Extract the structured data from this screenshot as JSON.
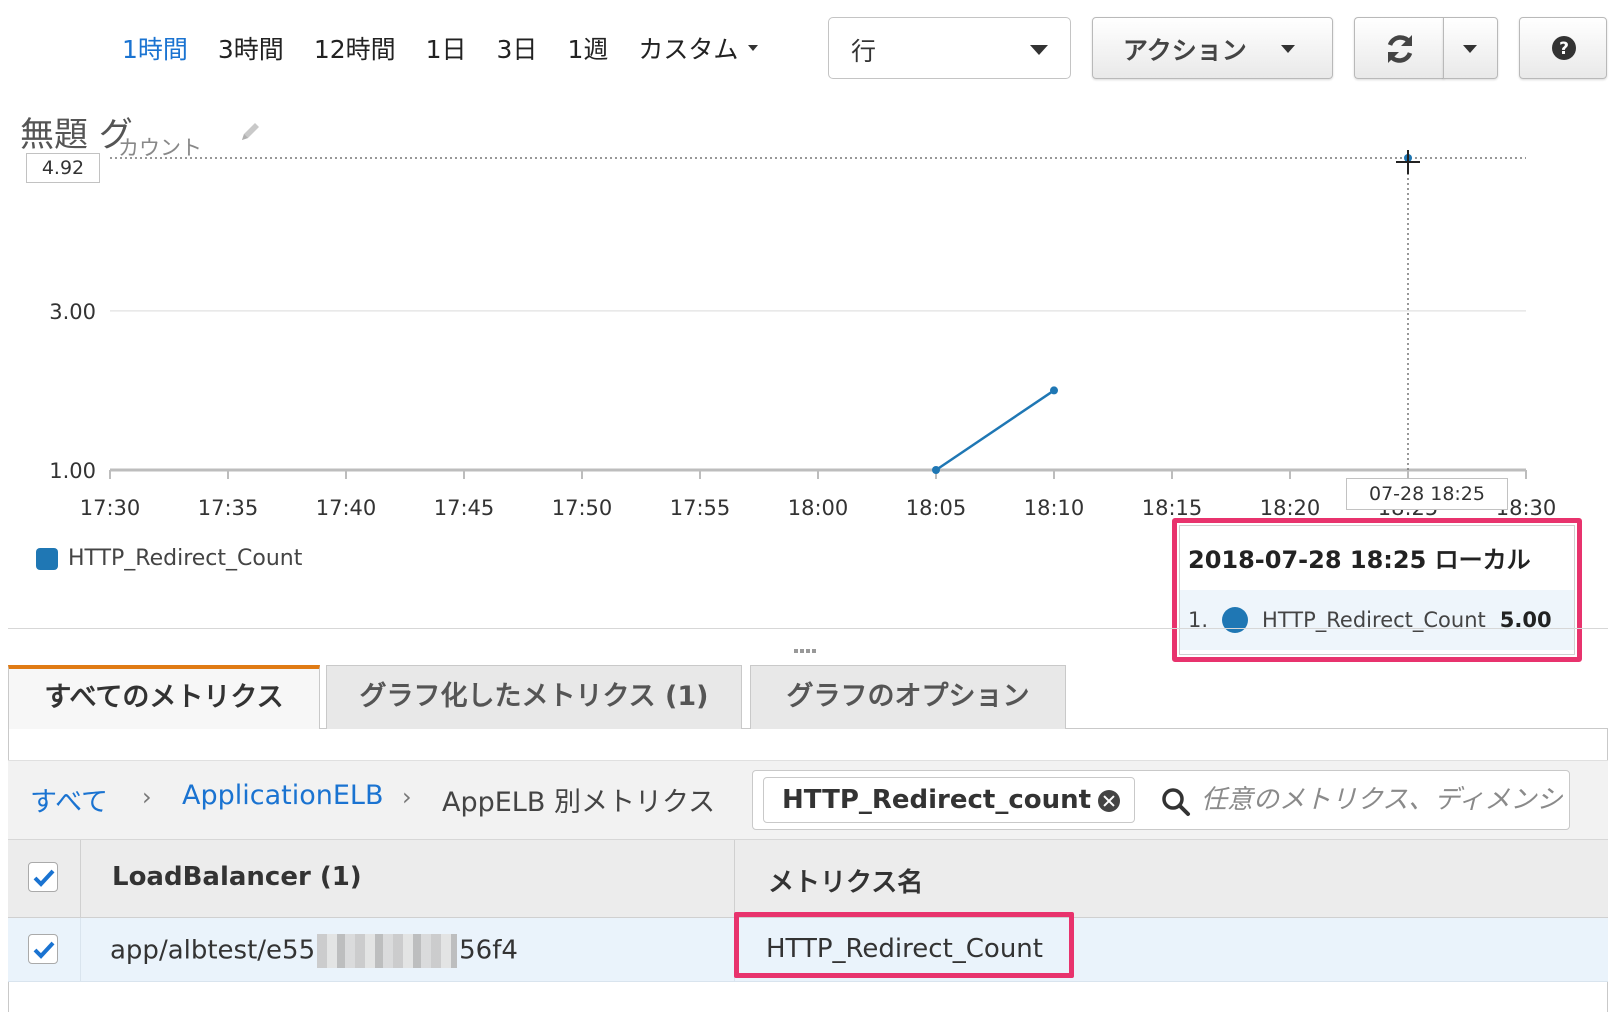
{
  "toolbar": {
    "ranges": [
      "1時間",
      "3時間",
      "12時間",
      "1日",
      "3日",
      "1週"
    ],
    "custom_label": "カスタム",
    "view_select_value": "行",
    "action_label": "アクション",
    "icons": {
      "refresh": "refresh-icon",
      "dropdown": "chevron-down-icon",
      "help": "help-icon"
    }
  },
  "graph": {
    "title": "無題 グ",
    "ylabel": "カウント",
    "hover_value": "4.92",
    "hover_time": "07-28 18:25",
    "edit_icon": "pencil-icon"
  },
  "chart_data": {
    "type": "line",
    "title": "無題 グ",
    "ylabel": "カウント",
    "xlabel": "",
    "x_ticks": [
      "17:30",
      "17:35",
      "17:40",
      "17:45",
      "17:50",
      "17:55",
      "18:00",
      "18:05",
      "18:10",
      "18:15",
      "18:20",
      "18:25",
      "18:30"
    ],
    "y_ticks": [
      "1.00",
      "3.00"
    ],
    "ylim": [
      1.0,
      4.92
    ],
    "grid": true,
    "legend_position": "bottom-left",
    "series": [
      {
        "name": "HTTP_Redirect_Count",
        "color": "#1f77b4",
        "points": [
          {
            "x": "18:05",
            "y": 1.0
          },
          {
            "x": "18:10",
            "y": 2.0
          },
          {
            "x": "18:25",
            "y": 5.0
          }
        ]
      }
    ]
  },
  "legend": {
    "series_name": "HTTP_Redirect_Count",
    "color": "#1f77b4"
  },
  "tooltip": {
    "header": "2018-07-28 18:25 ローカル",
    "index": "1.",
    "series": "HTTP_Redirect_Count",
    "value": "5.00"
  },
  "tabs": [
    "すべてのメトリクス",
    "グラフ化したメトリクス (1)",
    "グラフのオプション"
  ],
  "breadcrumb": {
    "all": "すべて",
    "namespace": "ApplicationELB",
    "dimension": "AppELB 別メトリクス",
    "separator": "›"
  },
  "search": {
    "token": "HTTP_Redirect_count",
    "placeholder": "任意のメトリクス、ディメンション"
  },
  "table": {
    "headers": [
      "LoadBalancer (1)",
      "メトリクス名"
    ],
    "rows": [
      {
        "lb_prefix": "app/albtest/e55",
        "lb_suffix": "56f4",
        "metric": "HTTP_Redirect_Count"
      }
    ]
  },
  "colors": {
    "accent_link": "#1a73d1",
    "tab_active": "#e07b14",
    "highlight": "#e8336d",
    "series": "#1f77b4"
  }
}
